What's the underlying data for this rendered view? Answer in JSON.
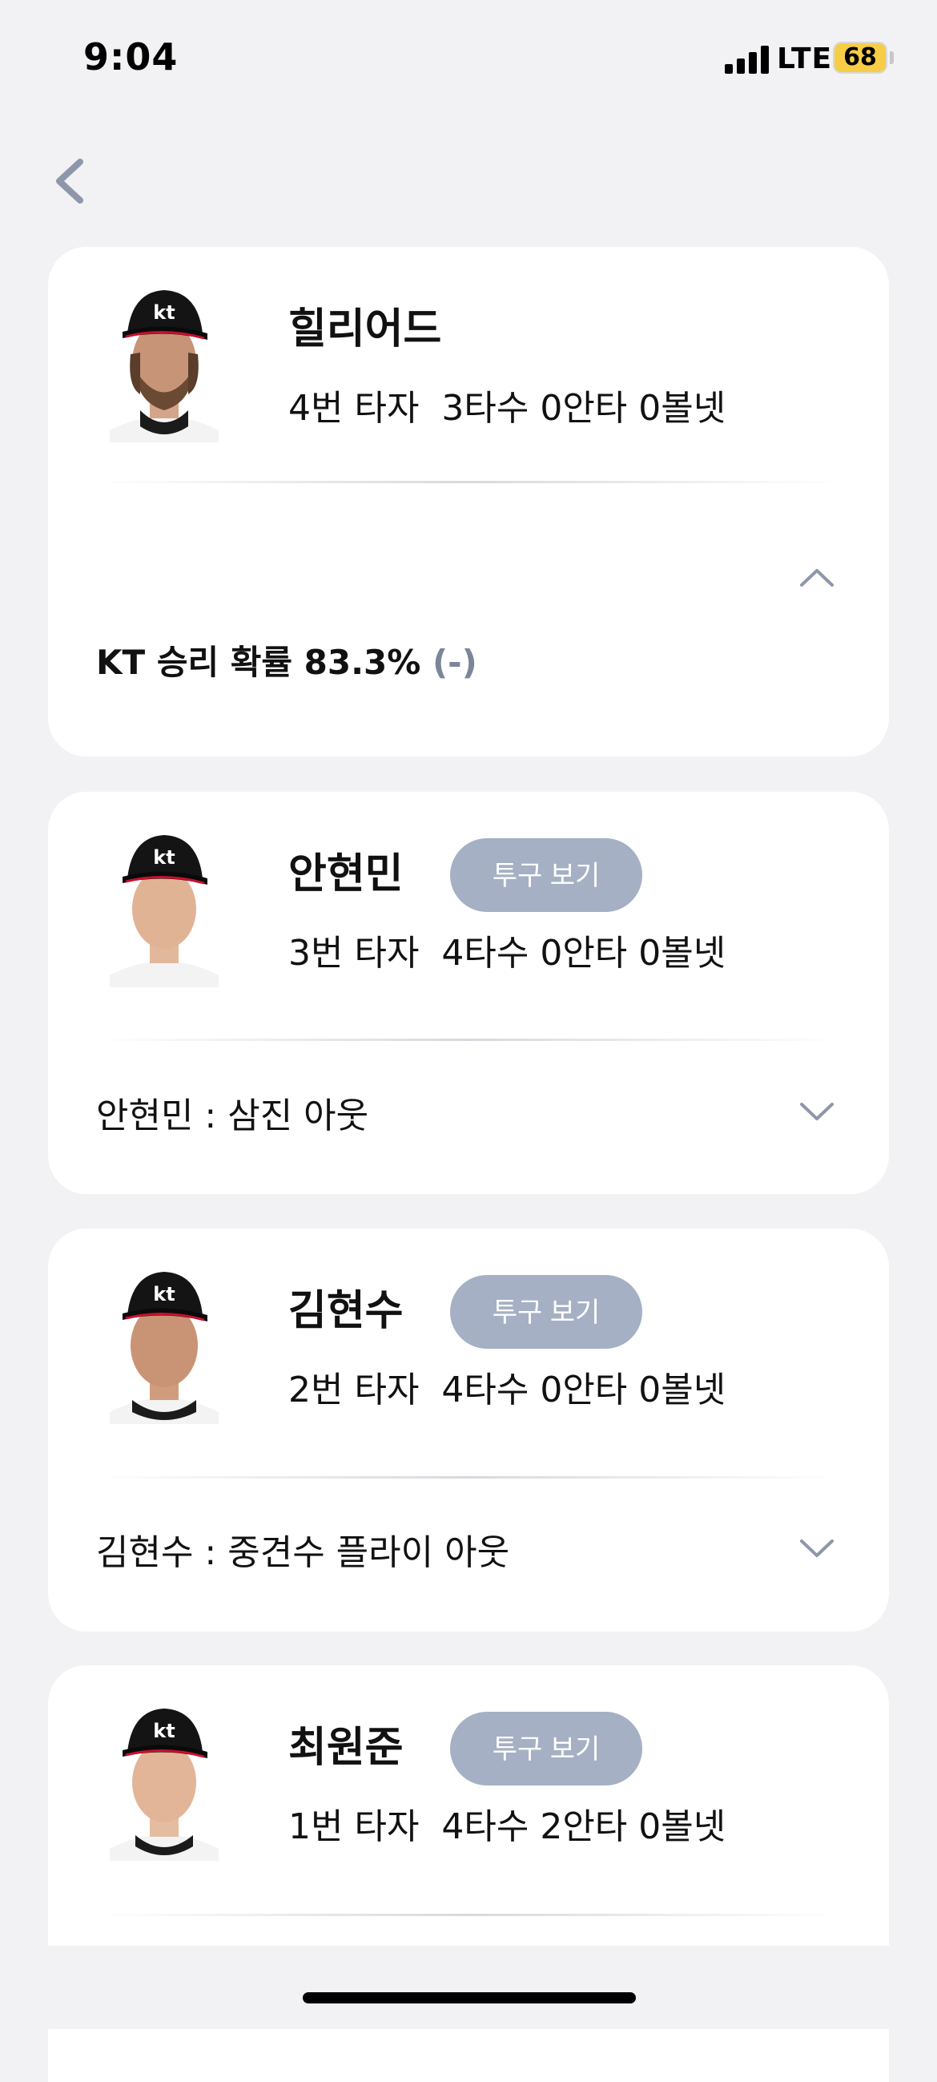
{
  "status_bar": {
    "time": "9:04",
    "network": "LTE",
    "battery": "68",
    "battery_color": "#f7cd47"
  },
  "nav": {
    "back_icon": "chevron-left-icon"
  },
  "colors": {
    "background": "#f2f2f4",
    "card": "#ffffff",
    "pill_button": "#a5b0c4",
    "muted_text": "#7c8699",
    "chevron": "#8e97aa"
  },
  "cards": [
    {
      "name": "힐리어드",
      "stats": "4번 타자  3타수 0안타 0볼넷",
      "expanded": true,
      "toggle_icon": "chevron-up-icon",
      "win_prob_label": "KT 승리 확률 83.3%",
      "win_prob_delta": "(-)"
    },
    {
      "name": "안현민",
      "pitch_button": "투구 보기",
      "stats": "3번 타자  4타수 0안타 0볼넷",
      "result": "안현민 : 삼진 아웃",
      "toggle_icon": "chevron-down-icon"
    },
    {
      "name": "김현수",
      "pitch_button": "투구 보기",
      "stats": "2번 타자  4타수 0안타 0볼넷",
      "result": "김현수 : 중견수 플라이 아웃",
      "toggle_icon": "chevron-down-icon"
    },
    {
      "name": "최원준",
      "pitch_button": "투구 보기",
      "stats": "1번 타자  4타수 2안타 0볼넷"
    }
  ]
}
